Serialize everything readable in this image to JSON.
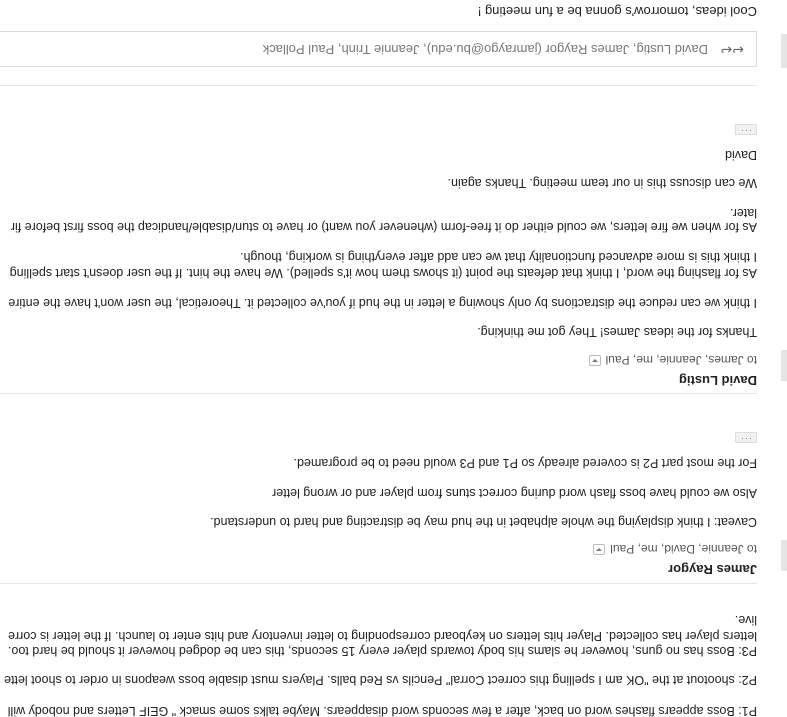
{
  "reply_box": {
    "recipients": "David Lustig, James Raygor (jamraygo@bu.edu), Jeannie Trinh, Paul Pollack",
    "draft_text": "Cool ideas, tomorrow's gonna be a fun meeting !"
  },
  "messages": [
    {
      "sender": "David Lustig",
      "to": "to James, Jeannie, me, Paul",
      "lines": [
        "Thanks for the ideas James!  They got me thinking.",
        "I think we can reduce the distractions by only showing a letter in the hud if you've collected it.  Theoretical, the user won't have the entire",
        "As for flashing the word, I think that defeats the point (it shows them how it's spelled).  We have the hint.  If the user doesn't start spelling",
        " I think this is more advanced functionality that we can add after everything is working, though.",
        "As for when we fire letters, we could either do it free-form (whenever you want) or have to stun/disable/handicap the boss first before fir",
        "later.",
        "We can discuss this in our team meeting.  Thanks again.",
        "David"
      ]
    },
    {
      "sender": "James Raygor",
      "to": "to Jeannie, David, me, Paul",
      "lines": [
        "Caveat: I think displaying the whole alphabet in the hud may be distracting and hard to understand.",
        "Also we could have boss flash word during correct stuns from player and or wrong letter",
        "For the most part P2 is covered already so P1 and P3 would need to be programed."
      ],
      "quoted": [
        "live.",
        "letters player has collected. Player hits letters on keyboard corresponding to letter inventory and hits enter to launch. If the letter is corre",
        "P3: Boss has no guns, however he slams his body towards player every 15 seconds, this can be dodged however it should be hard too.",
        "P2: shootout at the \"OK am I spelling this correct Corral\" Pencils vs Red balls. Players must disable boss weapons in order to shoot lette",
        "P1: Boss appears flashes word on back, after a few seconds word disappears. Maybe talks some smack \" GEIF Letters and nobody will"
      ]
    }
  ],
  "more_label": "···"
}
